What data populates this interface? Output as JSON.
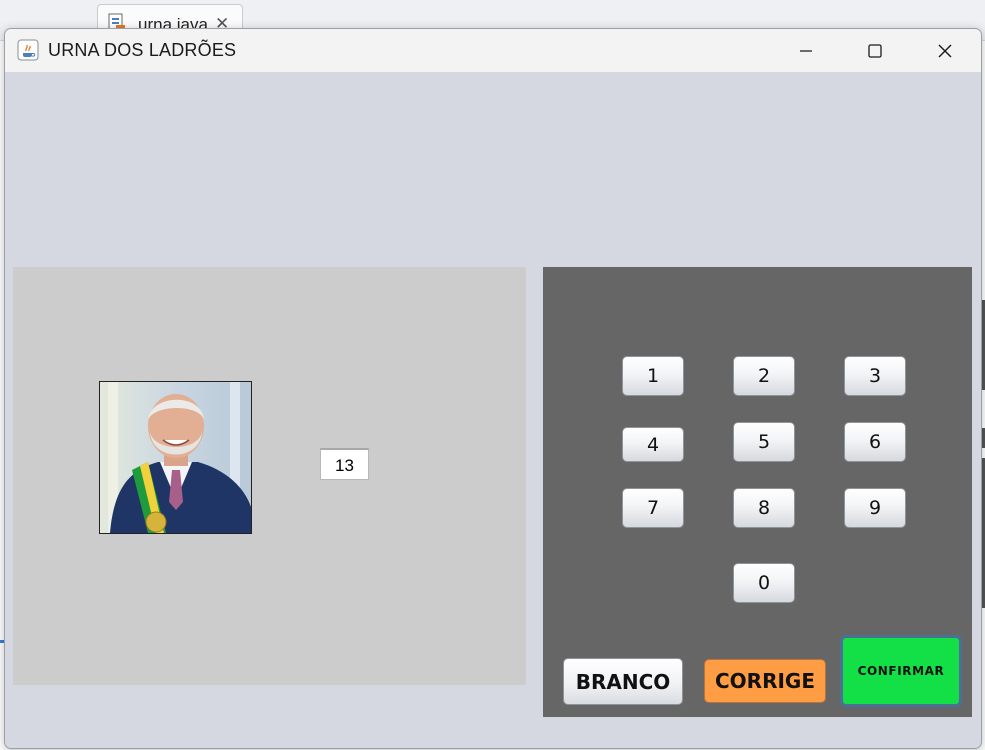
{
  "background_editor": {
    "tab_label": "urna.java",
    "tab_close": "✕"
  },
  "window": {
    "title": "URNA DOS LADRÕES",
    "controls": {
      "minimize": "minimize",
      "maximize": "maximize",
      "close": "close"
    }
  },
  "candidate": {
    "number": "13"
  },
  "keypad": {
    "keys": [
      "1",
      "2",
      "3",
      "4",
      "5",
      "6",
      "7",
      "8",
      "9",
      "0"
    ]
  },
  "actions": {
    "branco": "BRANCO",
    "corrige": "CORRIGE",
    "confirmar": "CONFIRMAR"
  },
  "colors": {
    "window_bg": "#d5d8e0",
    "left_panel": "#cccccc",
    "keypad_panel": "#666666",
    "corrige": "#ff9d45",
    "confirmar": "#12e046"
  }
}
